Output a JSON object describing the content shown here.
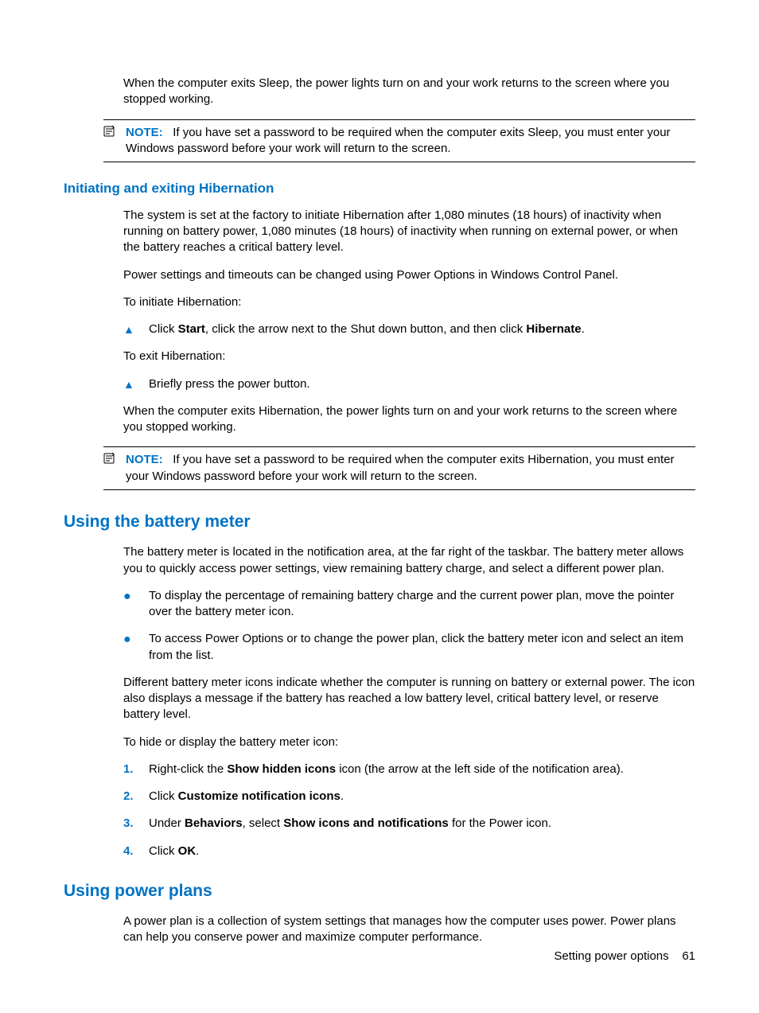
{
  "intro": {
    "p1": "When the computer exits Sleep, the power lights turn on and your work returns to the screen where you stopped working."
  },
  "note1": {
    "label": "NOTE:",
    "text": "If you have set a password to be required when the computer exits Sleep, you must enter your Windows password before your work will return to the screen."
  },
  "hibernation": {
    "heading": "Initiating and exiting Hibernation",
    "p1": "The system is set at the factory to initiate Hibernation after 1,080 minutes (18 hours) of inactivity when running on battery power, 1,080 minutes (18 hours) of inactivity when running on external power, or when the battery reaches a critical battery level.",
    "p2": "Power settings and timeouts can be changed using Power Options in Windows Control Panel.",
    "p3": "To initiate Hibernation:",
    "step1_pre": "Click ",
    "step1_b1": "Start",
    "step1_mid": ", click the arrow next to the Shut down button, and then click ",
    "step1_b2": "Hibernate",
    "step1_post": ".",
    "p4": "To exit Hibernation:",
    "step2": "Briefly press the power button.",
    "p5": "When the computer exits Hibernation, the power lights turn on and your work returns to the screen where you stopped working."
  },
  "note2": {
    "label": "NOTE:",
    "text": "If you have set a password to be required when the computer exits Hibernation, you must enter your Windows password before your work will return to the screen."
  },
  "battery": {
    "heading": "Using the battery meter",
    "p1": "The battery meter is located in the notification area, at the far right of the taskbar. The battery meter allows you to quickly access power settings, view remaining battery charge, and select a different power plan.",
    "b1": "To display the percentage of remaining battery charge and the current power plan, move the pointer over the battery meter icon.",
    "b2": "To access Power Options or to change the power plan, click the battery meter icon and select an item from the list.",
    "p2": "Different battery meter icons indicate whether the computer is running on battery or external power. The icon also displays a message if the battery has reached a low battery level, critical battery level, or reserve battery level.",
    "p3": "To hide or display the battery meter icon:",
    "n1_num": "1.",
    "n1_pre": "Right-click the ",
    "n1_b": "Show hidden icons",
    "n1_post": " icon (the arrow at the left side of the notification area).",
    "n2_num": "2.",
    "n2_pre": "Click ",
    "n2_b": "Customize notification icons",
    "n2_post": ".",
    "n3_num": "3.",
    "n3_pre": "Under ",
    "n3_b1": "Behaviors",
    "n3_mid": ", select ",
    "n3_b2": "Show icons and notifications",
    "n3_post": " for the Power icon.",
    "n4_num": "4.",
    "n4_pre": "Click ",
    "n4_b": "OK",
    "n4_post": "."
  },
  "plans": {
    "heading": "Using power plans",
    "p1": "A power plan is a collection of system settings that manages how the computer uses power. Power plans can help you conserve power and maximize computer performance."
  },
  "footer": {
    "text": "Setting power options",
    "page": "61"
  }
}
